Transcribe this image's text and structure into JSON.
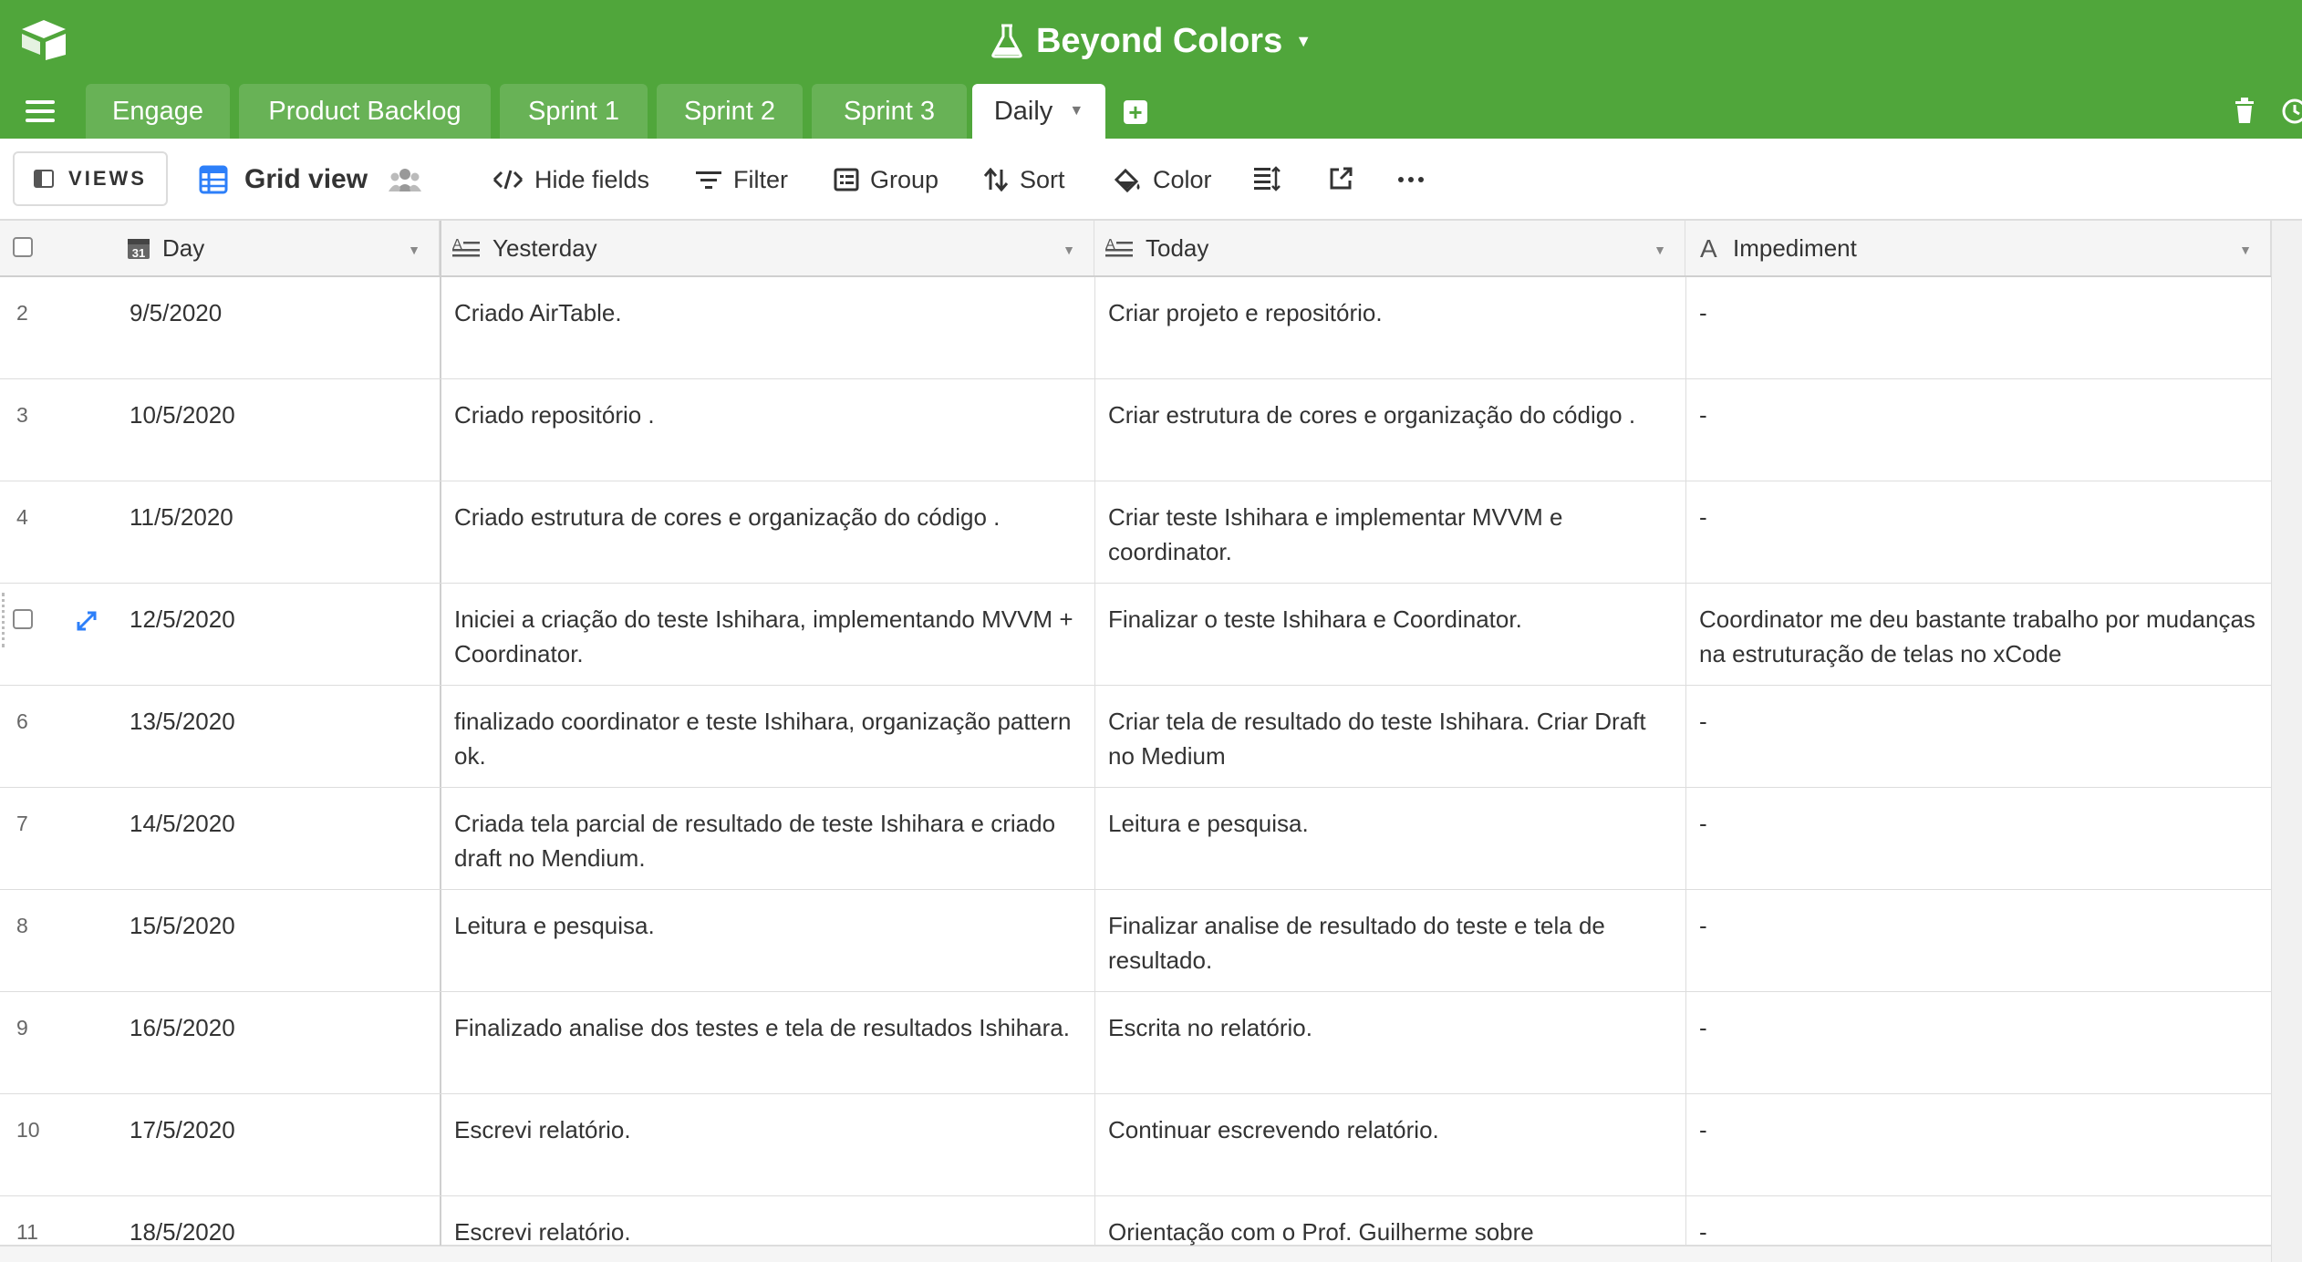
{
  "colors": {
    "brand_green": "#50a63b",
    "accent_blue": "#2d7ff9"
  },
  "base": {
    "title": "Beyond Colors",
    "icon": "flask-icon"
  },
  "tabs": [
    {
      "label": "Engage",
      "active": false
    },
    {
      "label": "Product Backlog",
      "active": false
    },
    {
      "label": "Sprint 1",
      "active": false
    },
    {
      "label": "Sprint 2",
      "active": false
    },
    {
      "label": "Sprint 3",
      "active": false
    },
    {
      "label": "Daily",
      "active": true
    }
  ],
  "viewbar": {
    "views_label": "VIEWS",
    "view_name": "Grid view",
    "tools": {
      "hide_fields": "Hide fields",
      "filter": "Filter",
      "group": "Group",
      "sort": "Sort",
      "color": "Color"
    }
  },
  "columns": {
    "day": "Day",
    "yesterday": "Yesterday",
    "today": "Today",
    "impediment": "Impediment"
  },
  "rows": [
    {
      "num": "2",
      "day": "9/5/2020",
      "yesterday": "Criado AirTable.",
      "today": "Criar projeto e repositório.",
      "impediment": "-"
    },
    {
      "num": "3",
      "day": "10/5/2020",
      "yesterday": "Criado repositório .",
      "today": "Criar estrutura de cores e organização do código .",
      "impediment": "-"
    },
    {
      "num": "4",
      "day": "11/5/2020",
      "yesterday": "Criado estrutura de cores e organização do código .",
      "today": "Criar teste Ishihara e implementar MVVM e coordinator.",
      "impediment": "-"
    },
    {
      "num": "",
      "day": "12/5/2020",
      "yesterday": "Iniciei a criação do teste Ishihara, implementando MVVM + Coordinator.",
      "today": "Finalizar o teste Ishihara e Coordinator.",
      "impediment": "Coordinator me deu bastante trabalho por mudanças na estruturação de telas no xCode"
    },
    {
      "num": "6",
      "day": "13/5/2020",
      "yesterday": "finalizado coordinator e teste Ishihara, organização pattern ok.",
      "today": "Criar tela de resultado do teste Ishihara. Criar Draft no Medium",
      "impediment": "-"
    },
    {
      "num": "7",
      "day": "14/5/2020",
      "yesterday": "Criada tela parcial de resultado de teste Ishihara e criado draft no Mendium.",
      "today": "Leitura e pesquisa.",
      "impediment": "-"
    },
    {
      "num": "8",
      "day": "15/5/2020",
      "yesterday": "Leitura e pesquisa.",
      "today": "Finalizar analise de resultado do teste e tela de resultado.",
      "impediment": "-"
    },
    {
      "num": "9",
      "day": "16/5/2020",
      "yesterday": "Finalizado analise dos testes e tela de resultados Ishihara.",
      "today": "Escrita no relatório.",
      "impediment": "-"
    },
    {
      "num": "10",
      "day": "17/5/2020",
      "yesterday": "Escrevi relatório.",
      "today": "Continuar escrevendo relatório.",
      "impediment": "-"
    },
    {
      "num": "11",
      "day": "18/5/2020",
      "yesterday": "Escrevi relatório.",
      "today": "Orientação com o Prof. Guilherme sobre",
      "impediment": "-"
    }
  ]
}
